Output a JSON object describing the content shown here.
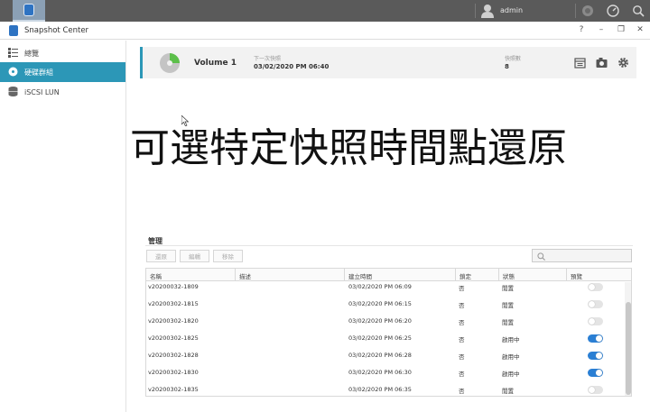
{
  "topbar": {
    "user": "admin"
  },
  "window": {
    "title": "Snapshot Center",
    "help": "?",
    "minimize": "–",
    "restore": "❐",
    "close": "✕"
  },
  "sidebar": {
    "items": [
      {
        "label": "總覽",
        "icon": "list-icon",
        "active": false
      },
      {
        "label": "硬碟群組",
        "icon": "disk-icon",
        "active": true
      },
      {
        "label": "iSCSI LUN",
        "icon": "database-icon",
        "active": false
      }
    ]
  },
  "volume": {
    "name": "Volume 1",
    "next_label": "下一次快照",
    "next_value": "03/02/2020 PM 06:40",
    "count_label": "快照數",
    "count_value": "8"
  },
  "caption": "可選特定快照時間點還原",
  "management": {
    "title": "管理",
    "buttons": [
      "還原",
      "編輯",
      "移除"
    ],
    "search_placeholder": "",
    "columns": [
      "名稱",
      "描述",
      "建立時間",
      "鎖定",
      "狀態",
      "預覽"
    ],
    "rows": [
      {
        "name": "v20200032-1809",
        "desc": "",
        "created": "03/02/2020 PM 06:09",
        "locked": "否",
        "status": "閒置",
        "preview": false
      },
      {
        "name": "v20200302-1815",
        "desc": "",
        "created": "03/02/2020 PM 06:15",
        "locked": "否",
        "status": "閒置",
        "preview": false
      },
      {
        "name": "v20200302-1820",
        "desc": "",
        "created": "03/02/2020 PM 06:20",
        "locked": "否",
        "status": "閒置",
        "preview": false
      },
      {
        "name": "v20200302-1825",
        "desc": "",
        "created": "03/02/2020 PM 06:25",
        "locked": "否",
        "status": "啟用中",
        "preview": true
      },
      {
        "name": "v20200302-1828",
        "desc": "",
        "created": "03/02/2020 PM 06:28",
        "locked": "否",
        "status": "啟用中",
        "preview": true
      },
      {
        "name": "v20200302-1830",
        "desc": "",
        "created": "03/02/2020 PM 06:30",
        "locked": "否",
        "status": "啟用中",
        "preview": true
      },
      {
        "name": "v20200302-1835",
        "desc": "",
        "created": "03/02/2020 PM 06:35",
        "locked": "否",
        "status": "閒置",
        "preview": false
      }
    ]
  },
  "colors": {
    "accent": "#2c97b7",
    "toggle_on": "#2a7fd4",
    "topbar": "#5a5a5a"
  }
}
